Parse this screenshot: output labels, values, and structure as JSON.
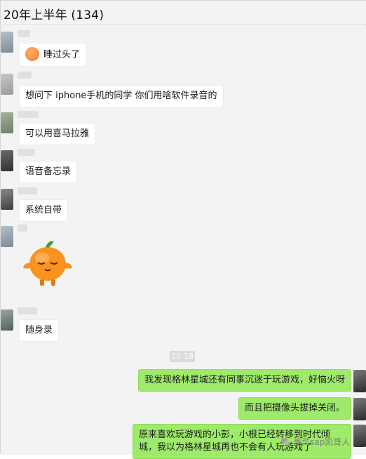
{
  "window": {
    "title": "20年上半年 (134)"
  },
  "messages": [
    {
      "text": "睡过头了"
    },
    {
      "text": "想问下 iphone手机的同学 你们用啥软件录音的"
    },
    {
      "text": "可以用喜马拉雅"
    },
    {
      "text": "语音备忘录"
    },
    {
      "text": "系统自带"
    },
    {
      "text": "随身录"
    }
  ],
  "timestamp": "20:18",
  "my_messages": [
    {
      "text": "我发现格林星城还有同事沉迷于玩游戏，好恼火呀"
    },
    {
      "text": "而且把摄像头拔掉关闭。"
    },
    {
      "text": "原来喜欢玩游戏的小彭，小根已经转移到时代倾城，我以为格林星城再也不会有人玩游戏了"
    }
  ],
  "watermark": {
    "text": "盖菜sap凯哥人"
  },
  "colors": {
    "bubble_green": "#9eea6a",
    "background": "#f3f3f3"
  },
  "icons": {
    "emoji": "sleepy-face-emoji",
    "sticker": "orange-character-sticker",
    "watermark": "wechat-icon"
  }
}
